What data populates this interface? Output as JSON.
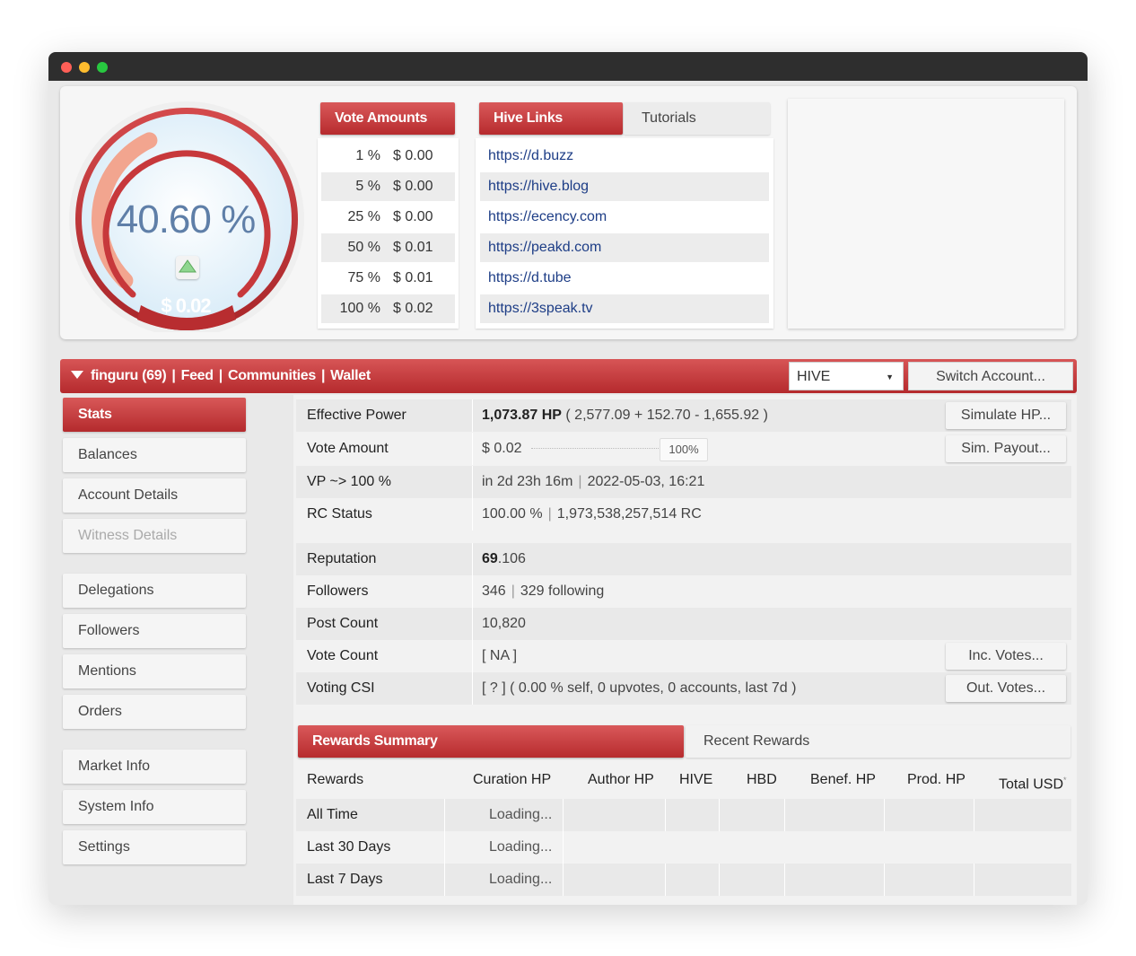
{
  "gauge": {
    "percent_label": "40.60 %",
    "value_label": "$ 0.02",
    "fill_fraction": 0.406,
    "colors": {
      "ring": "#c7383b",
      "fill": "#f2a58f",
      "bg": "#e7f3fb",
      "text": "#5f7fa8"
    }
  },
  "vote_amounts": {
    "tab_label": "Vote Amounts",
    "rows": [
      {
        "pct": "1 %",
        "val": "$ 0.00"
      },
      {
        "pct": "5 %",
        "val": "$ 0.00"
      },
      {
        "pct": "25 %",
        "val": "$ 0.00"
      },
      {
        "pct": "50 %",
        "val": "$ 0.01"
      },
      {
        "pct": "75 %",
        "val": "$ 0.01"
      },
      {
        "pct": "100 %",
        "val": "$ 0.02"
      }
    ]
  },
  "hive_links": {
    "tab_label": "Hive Links",
    "tutorials_label": "Tutorials",
    "links": [
      "https://d.buzz",
      "https://hive.blog",
      "https://ecency.com",
      "https://peakd.com",
      "https://d.tube",
      "https://3speak.tv"
    ]
  },
  "account_bar": {
    "account": "finguru (69)",
    "feed": "Feed",
    "communities": "Communities",
    "wallet": "Wallet",
    "separator": "|",
    "chain_select": "HIVE",
    "switch_button": "Switch Account..."
  },
  "sidebar": {
    "items": [
      "Stats",
      "Balances",
      "Account Details",
      "Witness Details",
      "Delegations",
      "Followers",
      "Mentions",
      "Orders",
      "Market Info",
      "System Info",
      "Settings"
    ]
  },
  "stats": {
    "effective_power": {
      "label": "Effective Power",
      "hp": "1,073.87 HP",
      "detail": "( 2,577.09 + 152.70 - 1,655.92 )",
      "button": "Simulate HP..."
    },
    "vote_amount": {
      "label": "Vote Amount",
      "value": "$ 0.02",
      "slider_pct": "100%",
      "button": "Sim. Payout..."
    },
    "vp": {
      "label": "VP ~> 100 %",
      "eta": "in 2d 23h 16m",
      "date": "2022-05-03, 16:21"
    },
    "rc": {
      "label": "RC Status",
      "pct": "100.00 %",
      "amount": "1,973,538,257,514 RC"
    },
    "reputation": {
      "label": "Reputation",
      "int": "69",
      "dec": ".106"
    },
    "followers": {
      "label": "Followers",
      "count": "346",
      "following": "329 following"
    },
    "post_count": {
      "label": "Post Count",
      "value": "10,820"
    },
    "vote_count": {
      "label": "Vote Count",
      "value": "[ NA ]",
      "button": "Inc. Votes..."
    },
    "voting_csi": {
      "label": "Voting CSI",
      "value": "[ ? ] ( 0.00 % self, 0 upvotes, 0 accounts, last 7d )",
      "button": "Out. Votes..."
    }
  },
  "rewards": {
    "tab_label": "Rewards Summary",
    "recent_label": "Recent Rewards",
    "headers": [
      "Rewards",
      "Curation HP",
      "Author HP",
      "HIVE",
      "HBD",
      "Benef. HP",
      "Prod. HP",
      "Total USD"
    ],
    "total_usd_mark": "*",
    "rows": [
      {
        "label": "All Time",
        "value": "Loading..."
      },
      {
        "label": "Last 30 Days",
        "value": "Loading..."
      },
      {
        "label": "Last 7 Days",
        "value": "Loading..."
      }
    ]
  }
}
